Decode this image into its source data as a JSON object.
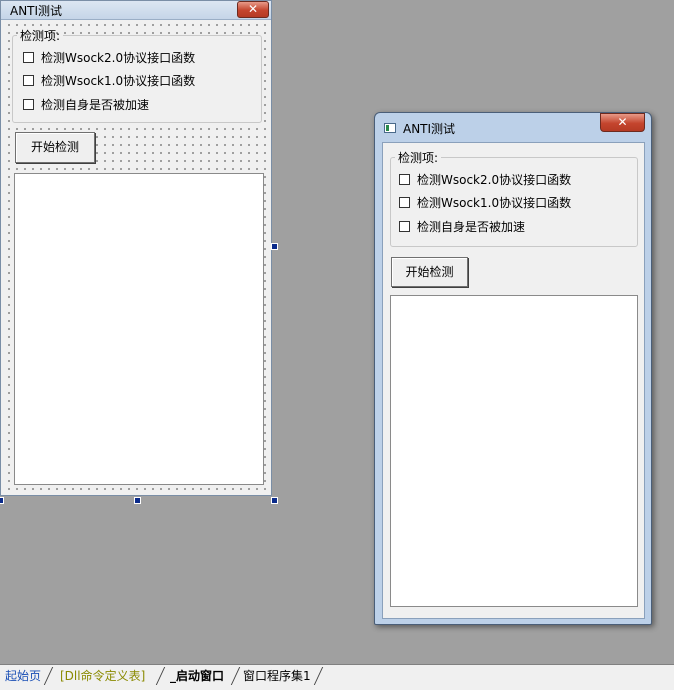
{
  "window_title": "ANTI测试",
  "close_glyph": "✕",
  "group_label": "检测项:",
  "checkboxes": [
    {
      "label": "检测Wsock2.0协议接口函数",
      "checked": false
    },
    {
      "label": "检测Wsock1.0协议接口函数",
      "checked": false
    },
    {
      "label": "检测自身是否被加速",
      "checked": false
    }
  ],
  "start_button": "开始检测",
  "tabs": [
    {
      "label": "起始页",
      "color": "#1a4fb5"
    },
    {
      "label": "[Dll命令定义表]",
      "color": "#8a8a00"
    },
    {
      "label": "_启动窗口",
      "color": "#000000",
      "active": true
    },
    {
      "label": "窗口程序集1",
      "color": "#000000"
    }
  ],
  "colors": {
    "workspace": "#a0a0a0",
    "client": "#f0f0f0",
    "close_button": "#c4452e"
  }
}
